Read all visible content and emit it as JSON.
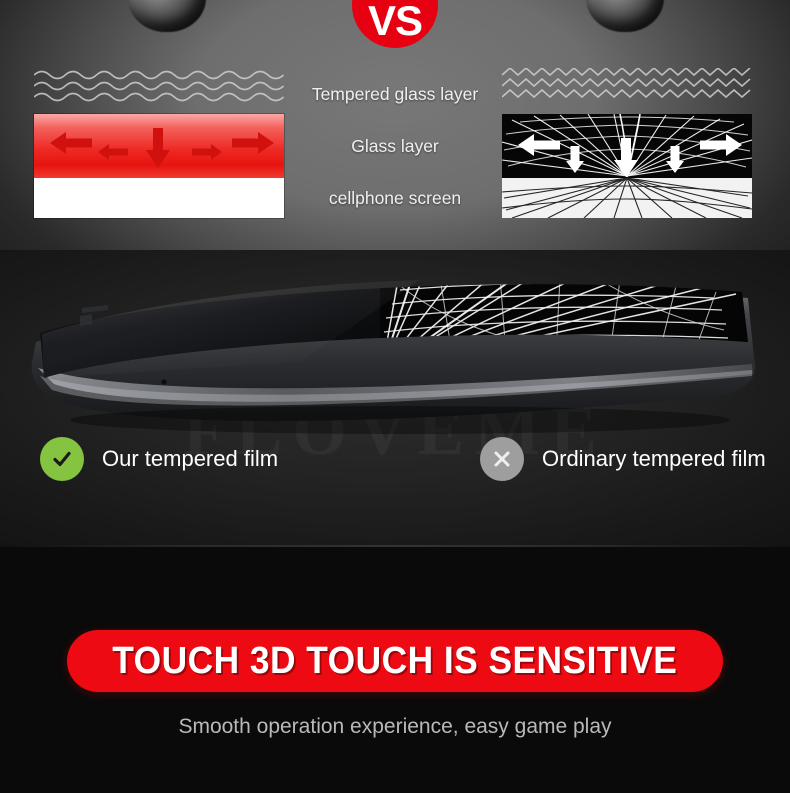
{
  "product_page": {
    "top_section": {
      "vs_badge": "VS",
      "layer_labels": [
        "Tempered glass layer",
        "Glass layer",
        "cellphone screen"
      ],
      "left_diagram": {
        "name": "protected-screen-diagram",
        "wave_type": "smooth-wave",
        "band_color": "#ee2a25",
        "base_color": "#ffffff",
        "arrow_count": 5
      },
      "right_diagram": {
        "name": "broken-screen-diagram",
        "wave_type": "sharp-zigzag",
        "band_color": "#060606",
        "base_color": "#f2f2f2",
        "arrow_count": 5
      },
      "impact_objects": 2
    },
    "phone_section": {
      "watermark": "FLOVEME",
      "comparison": [
        {
          "icon": "check-icon",
          "label": "Our tempered film",
          "badge_color": "#85c440",
          "status": "good"
        },
        {
          "icon": "close-icon",
          "label": "Ordinary tempered film",
          "badge_color": "#9e9e9e",
          "status": "bad"
        }
      ]
    },
    "bottom_section": {
      "banner_text": "TOUCH 3D TOUCH IS SENSITIVE",
      "banner_color": "#ee0a12",
      "sub_caption": "Smooth operation experience, easy game play"
    }
  }
}
